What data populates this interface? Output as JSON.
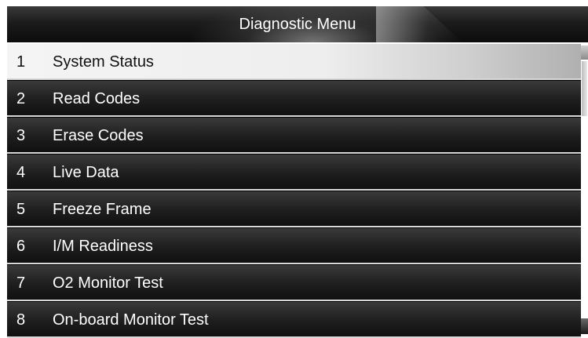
{
  "header": {
    "title": "Diagnostic Menu"
  },
  "menu": {
    "selected_index": 0,
    "items": [
      {
        "number": "1",
        "label": "System Status"
      },
      {
        "number": "2",
        "label": "Read Codes"
      },
      {
        "number": "3",
        "label": "Erase Codes"
      },
      {
        "number": "4",
        "label": "Live Data"
      },
      {
        "number": "5",
        "label": "Freeze Frame"
      },
      {
        "number": "6",
        "label": "I/M Readiness"
      },
      {
        "number": "7",
        "label": "O2 Monitor Test"
      },
      {
        "number": "8",
        "label": "On-board Monitor Test"
      }
    ]
  },
  "colors": {
    "selected_row": "#eeeeee",
    "row_background": "#1e1e1e",
    "row_divider": "#d8d8d8",
    "text_light": "#ffffff",
    "text_dark": "#111111"
  }
}
